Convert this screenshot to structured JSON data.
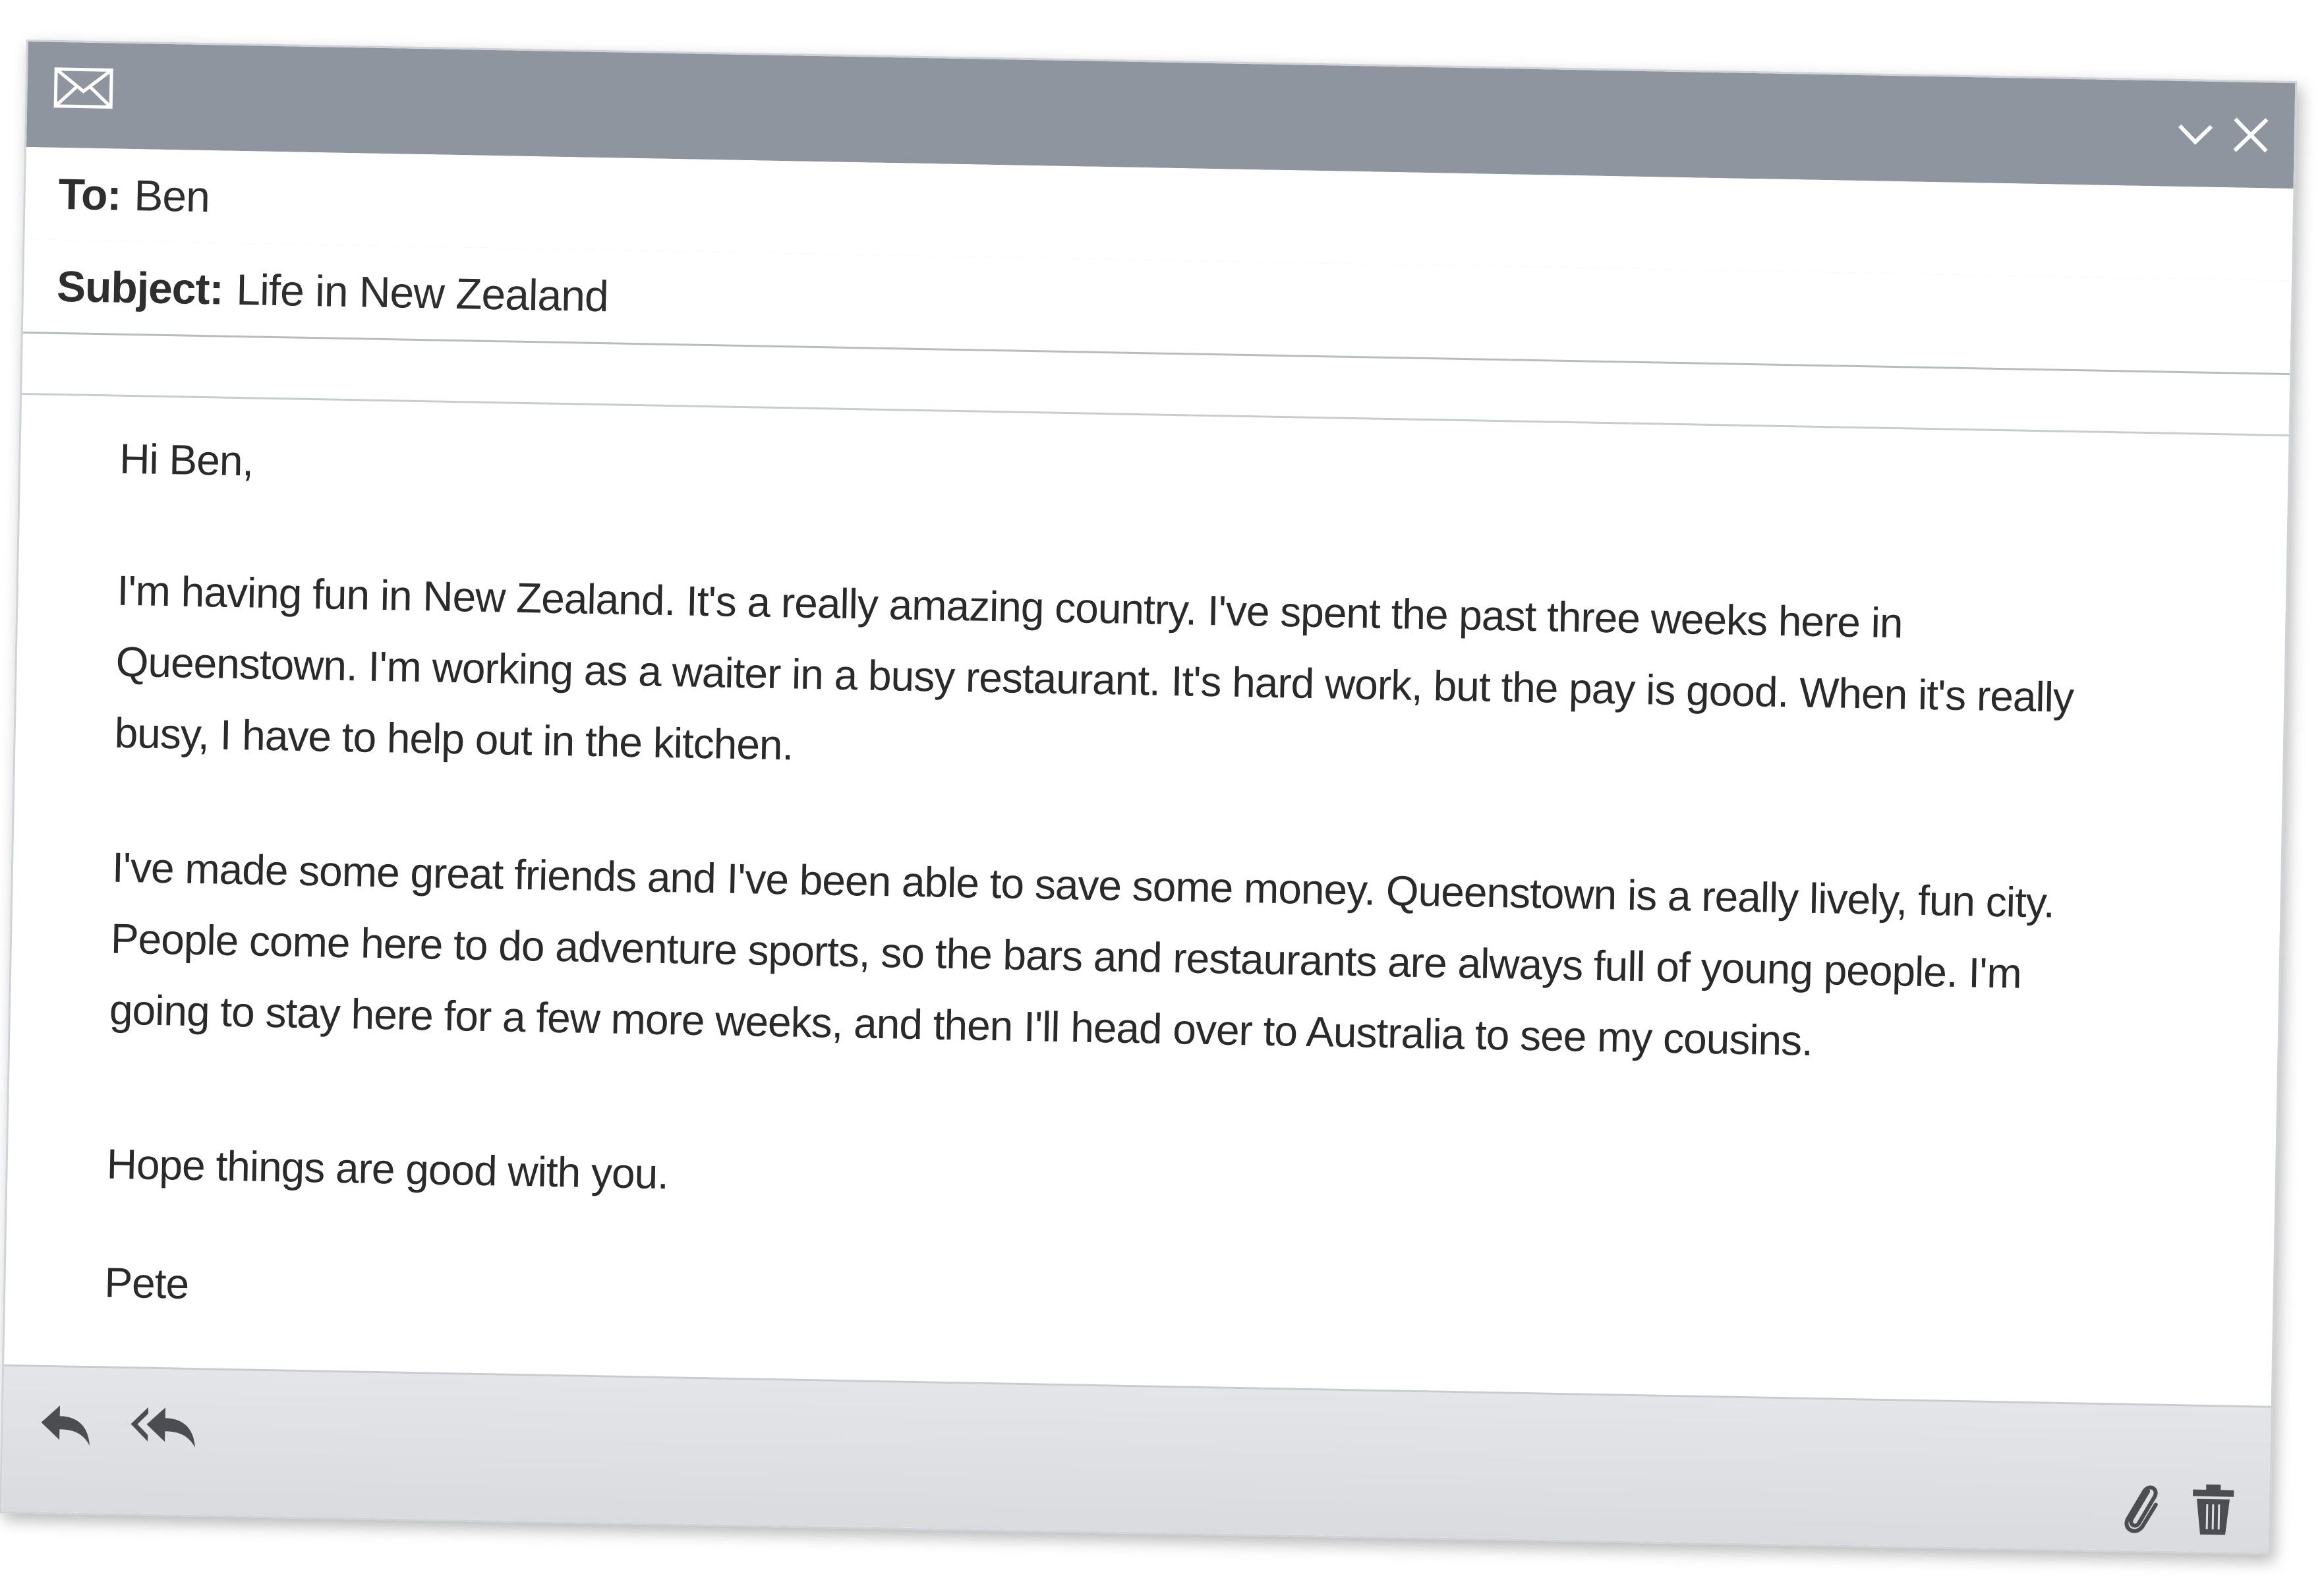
{
  "window": {
    "controls": [
      "chevron-down-icon",
      "close-icon"
    ],
    "title_icon": "envelope-icon"
  },
  "header": {
    "to_label": "To:",
    "to_value": "Ben",
    "subject_label": "Subject:",
    "subject_value": "Life in New Zealand"
  },
  "body": {
    "greeting": "Hi Ben,",
    "paragraphs": [
      "I'm having fun in New Zealand. It's a really amazing country. I've spent the past three weeks here in Queenstown. I'm working as a waiter in a busy restaurant. It's hard work, but the pay is good. When it's really busy, I have to help out in the kitchen.",
      "I've made some great friends and I've been able to save some money. Queenstown is a really lively, fun city. People come here to do adventure sports, so the bars and restaurants are always full of young people. I'm going to stay here for a few more weeks, and then I'll head over to Australia to see my cousins.",
      "Hope things are good with you."
    ],
    "signature": "Pete"
  },
  "footer": {
    "left_icons": [
      "reply-icon",
      "reply-all-icon"
    ],
    "right_icons": [
      "paperclip-icon",
      "trash-icon"
    ]
  },
  "colors": {
    "titlebar": "#8e959e",
    "footer": "#dcdee1",
    "icon": "#4a4d52"
  }
}
